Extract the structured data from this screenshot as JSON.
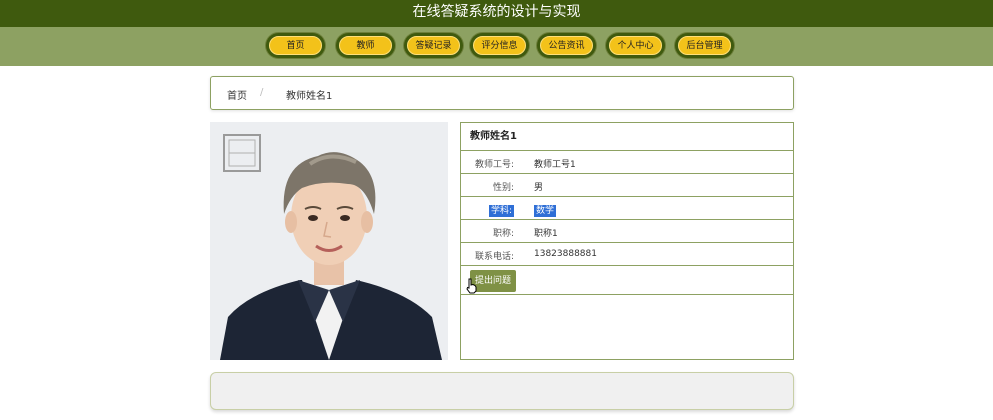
{
  "site_title": "在线答疑系统的设计与实现",
  "nav": {
    "items": [
      {
        "label": "首页"
      },
      {
        "label": "教师"
      },
      {
        "label": "答疑记录"
      },
      {
        "label": "评分信息"
      },
      {
        "label": "公告资讯"
      },
      {
        "label": "个人中心"
      },
      {
        "label": "后台管理"
      }
    ]
  },
  "breadcrumb": {
    "home": "首页",
    "separator": "/",
    "current": "教师姓名1"
  },
  "teacher": {
    "name": "教师姓名1",
    "fields": [
      {
        "label": "教师工号:",
        "value": "教师工号1"
      },
      {
        "label": "性别:",
        "value": "男"
      },
      {
        "label": "学科:",
        "value": "数学"
      },
      {
        "label": "职称:",
        "value": "职称1"
      },
      {
        "label": "联系电话:",
        "value": "13823888881"
      }
    ],
    "ask_button": "提出问题"
  },
  "colors": {
    "dark_green": "#3f5a0e",
    "olive": "#8da162",
    "nav_yellow": "#f3c21a",
    "selection_blue": "#2f6fd6",
    "button_green": "#7f9145"
  }
}
